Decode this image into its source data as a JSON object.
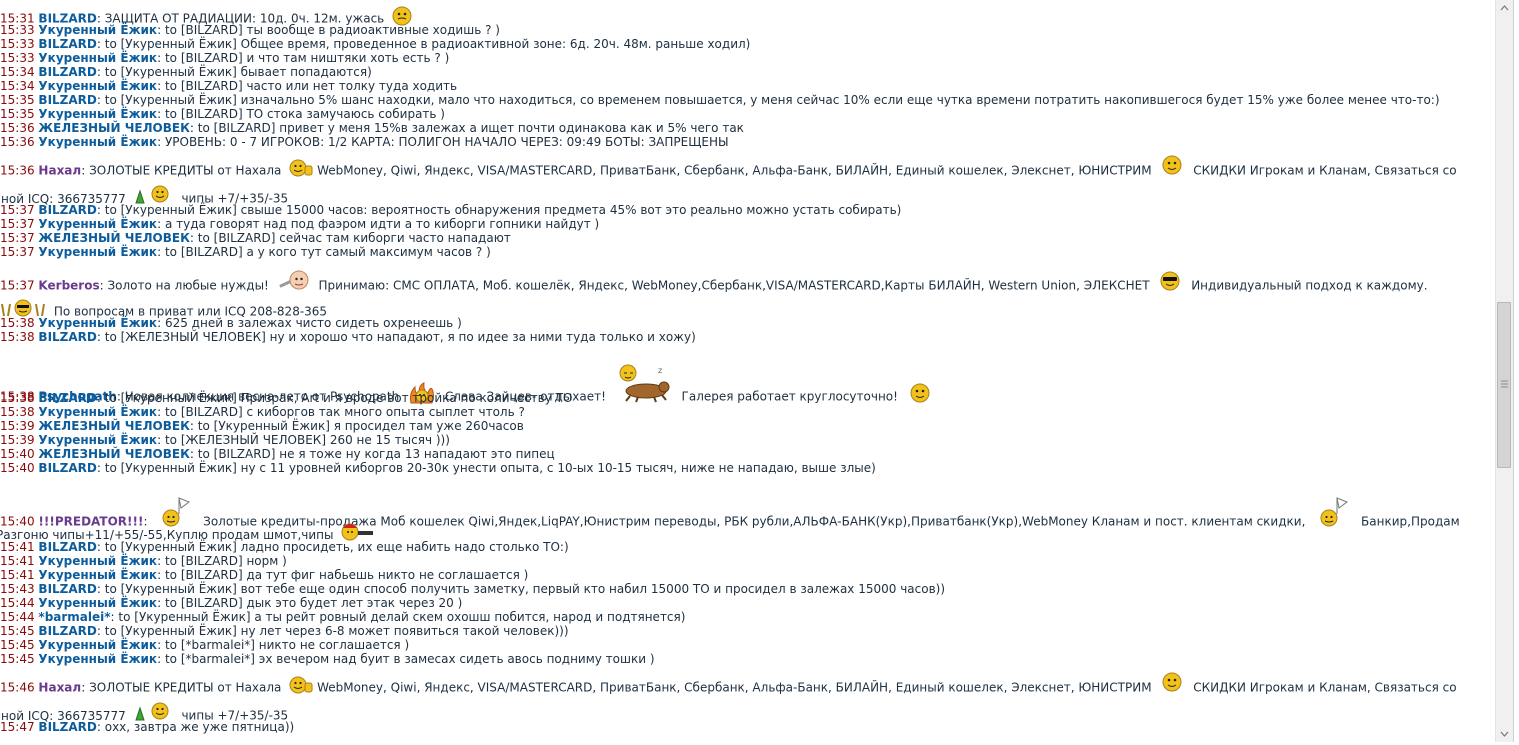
{
  "messages": [
    {
      "time": "15:31",
      "nick": "BILZARD",
      "text": "ЗАЩИТА ОТ РАДИАЦИИ: 10д. 0ч. 12м. ужась"
    },
    {
      "time": "15:33",
      "nick": "Укуренный Ёжик",
      "text": "to [BILZARD] ты вообще в радиоактивные ходишь ? )"
    },
    {
      "time": "15:33",
      "nick": "BILZARD",
      "text": "to [Укуренный Ёжик] Общее время, проведенное в радиоактивной зоне: 6д. 20ч. 48м. раньше ходил)"
    },
    {
      "time": "15:33",
      "nick": "Укуренный Ёжик",
      "text": "to [BILZARD] и что там ништяки хоть есть ? )"
    },
    {
      "time": "15:34",
      "nick": "BILZARD",
      "text": "to [Укуренный Ёжик] бывает попадаются)"
    },
    {
      "time": "15:34",
      "nick": "Укуренный Ёжик",
      "text": "to [BILZARD] часто или нет толку туда ходить"
    },
    {
      "time": "15:35",
      "nick": "BILZARD",
      "text": "to [Укуренный Ёжик] изначально 5% шанс находки, мало что находиться, со временем повышается, у меня сейчас 10% если еще чутка времени потратить накопившегося будет 15% уже более менее что-то:)"
    },
    {
      "time": "15:35",
      "nick": "Укуренный Ёжик",
      "text": "to [BILZARD] ТО стока замучаюсь собирать )"
    },
    {
      "time": "15:36",
      "nick": "ЖЕЛЕЗНЫЙ ЧЕЛОВЕК",
      "text": "to [BILZARD] привет у меня 15%в залежах а ищет почти одинакова как и 5% чего так"
    },
    {
      "time": "15:36",
      "nick": "Укуренный Ёжик",
      "text": "УРОВЕНЬ: 0 - 7 ИГРОКОВ: 1/2 КАРТА: ПОЛИГОН НАЧАЛО ЧЕРЕЗ: 09:49 БОТЫ: ЗАПРЕЩЕНЫ"
    },
    {
      "time": "15:36",
      "nick": "Нахал",
      "text": "ЗОЛОТЫЕ КРЕДИТЫ от Нахала",
      "t2": "WebMoney, Qiwi, Яндекс, VISA/MASTERCARD, ПриватБанк, Сбербанк, Альфа-Банк, БИЛАЙН, Единый кошелек, Элекснет, ЮНИСТРИМ",
      "t3": "СКИДКИ Игрокам и Кланам, Связаться со",
      "t4": "мной ICQ: 366735777",
      "t5": "чипы +7/+35/-35"
    },
    {
      "time": "15:37",
      "nick": "BILZARD",
      "text": "to [Укуренный Ёжик] свыше 15000 часов: вероятность обнаружения предмета 45% вот это реально можно устать собирать)"
    },
    {
      "time": "15:37",
      "nick": "Укуренный Ёжик",
      "text": "а туда говорят над под фаэром идти а то киборги гопники найдут )"
    },
    {
      "time": "15:37",
      "nick": "ЖЕЛЕЗНЫЙ ЧЕЛОВЕК",
      "text": "to [BILZARD] сейчас там киборги часто нападают"
    },
    {
      "time": "15:37",
      "nick": "Укуренный Ёжик",
      "text": "to [BILZARD] а у кого тут самый максимум часов ? )"
    },
    {
      "time": "15:37",
      "nick": "Kerberos",
      "text": "Золото на любые нужды!",
      "t2": "Принимаю: СМС ОПЛАТА, Моб. кошелёк, Яндекс, WebMoney,Сбербанк,VISA/MASTERCARD,Карты БИЛАЙН, Western Union, ЭЛЕКСНЕТ",
      "t3": "Индивидуальный подход к каждому.",
      "t4": "По вопросам в приват или ICQ 208-828-365"
    },
    {
      "time": "15:38",
      "nick": "Укуренный Ёжик",
      "text": "625 дней в залежах чисто сидеть охренеешь )"
    },
    {
      "time": "15:38",
      "nick": "BILZARD",
      "text": "to [ЖЕЛЕЗНЫЙ ЧЕЛОВЕК] ну и хорошо что нападают, я по идее за ними туда только и хожу)"
    },
    {
      "time": "15:38",
      "nick": "Psychopath",
      "text": "Новая коллекция весна-лето от Psychopath",
      "t2": "Слава Зайцев- отдыхает!",
      "t3": "Галерея работает круглосуточно!"
    },
    {
      "time": "15:38",
      "nick": "BILZARD",
      "text": "to [Укуренный Ёжик] Призрак, Art и я вроде вот тройка по количеству ТО"
    },
    {
      "time": "15:38",
      "nick": "Укуренный Ёжик",
      "text": "to [BILZARD] с киборгов так много опыта сыплет чтоль ?"
    },
    {
      "time": "15:39",
      "nick": "ЖЕЛЕЗНЫЙ ЧЕЛОВЕК",
      "text": "to [Укуренный Ёжик] я просидел там уже 260часов"
    },
    {
      "time": "15:39",
      "nick": "Укуренный Ёжик",
      "text": "to [ЖЕЛЕЗНЫЙ ЧЕЛОВЕК] 260 не 15 тысяч )))"
    },
    {
      "time": "15:40",
      "nick": "ЖЕЛЕЗНЫЙ ЧЕЛОВЕК",
      "text": "to [BILZARD] не я тоже ну когда 13 нападают это пипец"
    },
    {
      "time": "15:40",
      "nick": "BILZARD",
      "text": "to [Укуренный Ёжик] ну с 11 уровней киборгов 20-30к унести опыта, с 10-ых 10-15 тысяч, ниже не нападаю, выше злые)"
    },
    {
      "time": "15:40",
      "nick": "!!!PREDATOR!!!",
      "text": "Золотые кредиты-продажа Моб кошелек Qiwi,Яндек,LiqPAY,Юнистрим переводы, РБК рубли,АЛЬФА-БАНК(Укр),Приватбанк(Укр),WebMoney Кланам и пост. клиентам скидки,",
      "t2": "Банкир,Продам",
      "t3": "Разгоню чипы+11/+55/-55,Куплю продам шмот,чипы"
    },
    {
      "time": "15:41",
      "nick": "BILZARD",
      "text": "to [Укуренный Ёжик] ладно просидеть, их еще набить надо столько ТО:)"
    },
    {
      "time": "15:41",
      "nick": "Укуренный Ёжик",
      "text": "to [BILZARD] норм )"
    },
    {
      "time": "15:41",
      "nick": "Укуренный Ёжик",
      "text": "to [BILZARD] да тут фиг набьешь никто не соглашается )"
    },
    {
      "time": "15:43",
      "nick": "BILZARD",
      "text": "to [Укуренный Ёжик] вот тебе еще один способ получить заметку, первый кто набил 15000 ТО и просидел в залежах 15000 часов))"
    },
    {
      "time": "15:44",
      "nick": "Укуренный Ёжик",
      "text": "to [BILZARD] дык это будет лет этак через 20 )"
    },
    {
      "time": "15:44",
      "nick": "*barmalei*",
      "text": "to [Укуренный Ёжик] а ты рейт ровный делай скем охошш побится, народ и подтянется)"
    },
    {
      "time": "15:45",
      "nick": "BILZARD",
      "text": "to [Укуренный Ёжик] ну лет через 6-8 может появиться такой человек)))"
    },
    {
      "time": "15:45",
      "nick": "Укуренный Ёжик",
      "text": "to [*barmalei*] никто не соглашается )"
    },
    {
      "time": "15:45",
      "nick": "Укуренный Ёжик",
      "text": "to [*barmalei*] эх вечером над буит в замесах сидеть авось подниму тошки )"
    },
    {
      "time": "15:46",
      "nick": "Нахал",
      "text": "ЗОЛОТЫЕ КРЕДИТЫ от Нахала",
      "t2": "WebMoney, Qiwi, Яндекс, VISA/MASTERCARD, ПриватБанк, Сбербанк, Альфа-Банк, БИЛАЙН, Единый кошелек, Элекснет, ЮНИСТРИМ",
      "t3": "СКИДКИ Игрокам и Кланам, Связаться со",
      "t4": "мной ICQ: 366735777",
      "t5": "чипы +7/+35/-35"
    },
    {
      "time": "15:47",
      "nick": "BILZARD",
      "text": "охх, завтра же уже пятница))"
    }
  ],
  "colors": {
    "time": "#8a0a0a",
    "nick": "#0d5c9c",
    "advertiser_nick": "#6b3a8c",
    "text": "#1d2f40",
    "smiley": "#f2c21b"
  }
}
